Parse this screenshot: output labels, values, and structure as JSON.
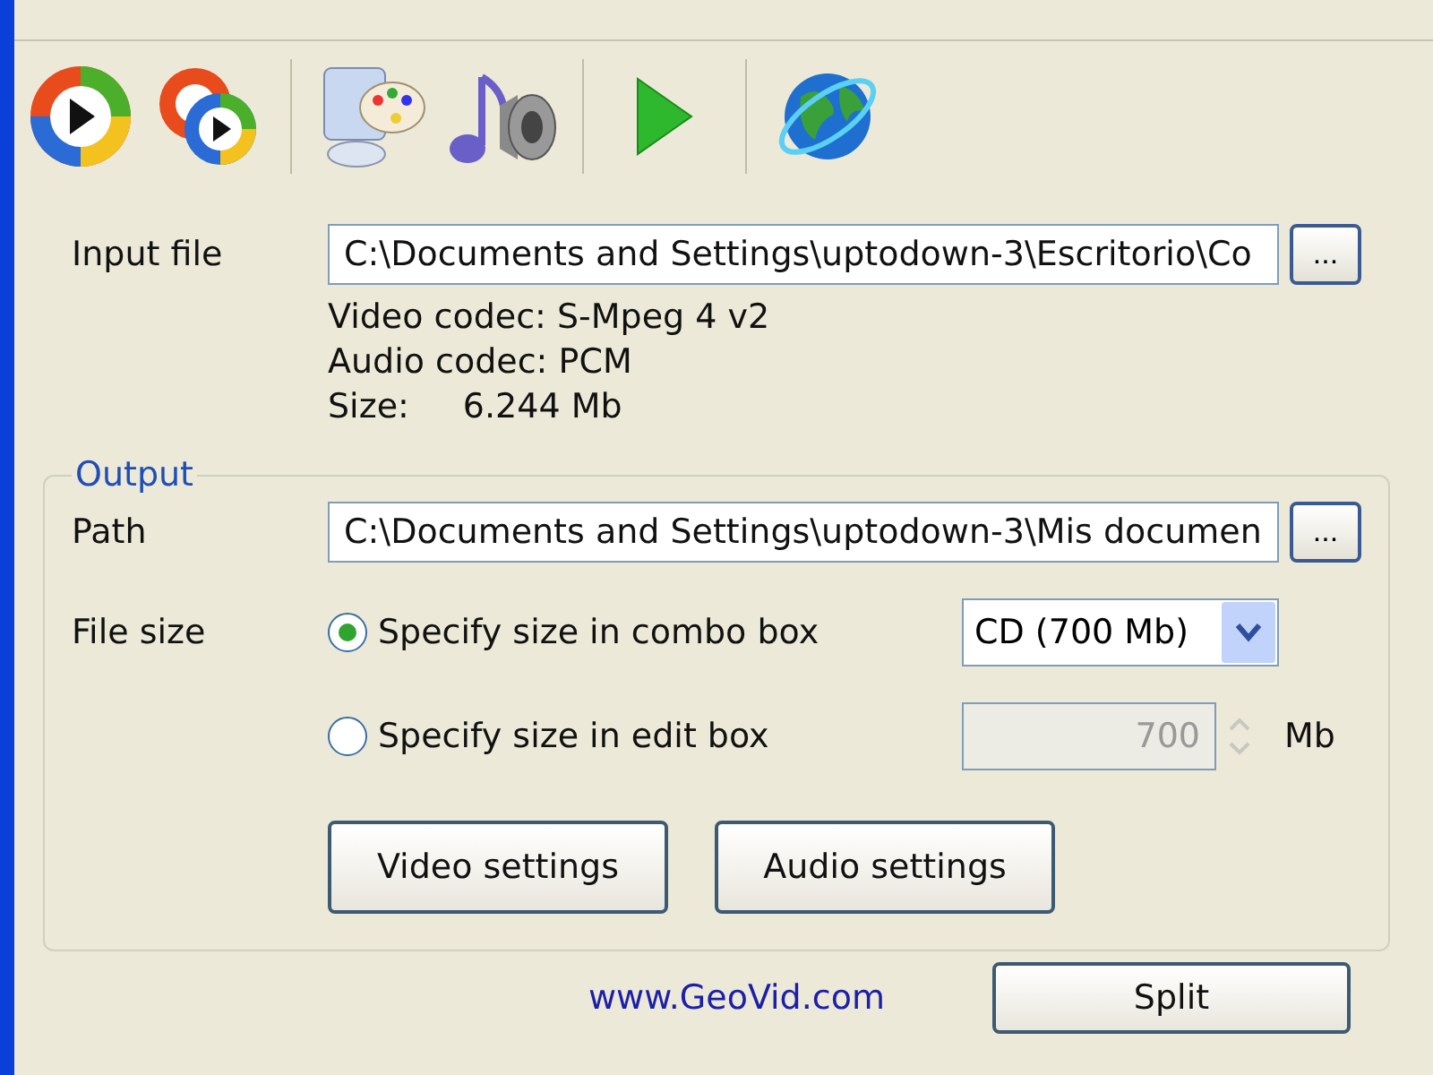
{
  "input": {
    "label": "Input file",
    "value": "C:\\Documents and Settings\\uptodown-3\\Escritorio\\Co",
    "browse": "...",
    "info": [
      "Video codec: S-Mpeg 4 v2",
      "Audio codec: PCM"
    ],
    "size_label": "Size:",
    "size_value": "6.244 Mb"
  },
  "output": {
    "legend": "Output",
    "path_label": "Path",
    "path_value": "C:\\Documents and Settings\\uptodown-3\\Mis documen",
    "browse": "...",
    "file_size_label": "File size",
    "options": [
      {
        "label": "Specify size in combo box",
        "selected": true,
        "kind": "combo",
        "value": "CD (700 Mb)"
      },
      {
        "label": "Specify size in edit box",
        "selected": false,
        "kind": "spin",
        "value": "700",
        "unit": "Mb",
        "disabled": true
      }
    ],
    "buttons": [
      "Video settings",
      "Audio settings"
    ]
  },
  "footer": {
    "link": "www.GeoVid.com",
    "button": "Split"
  }
}
